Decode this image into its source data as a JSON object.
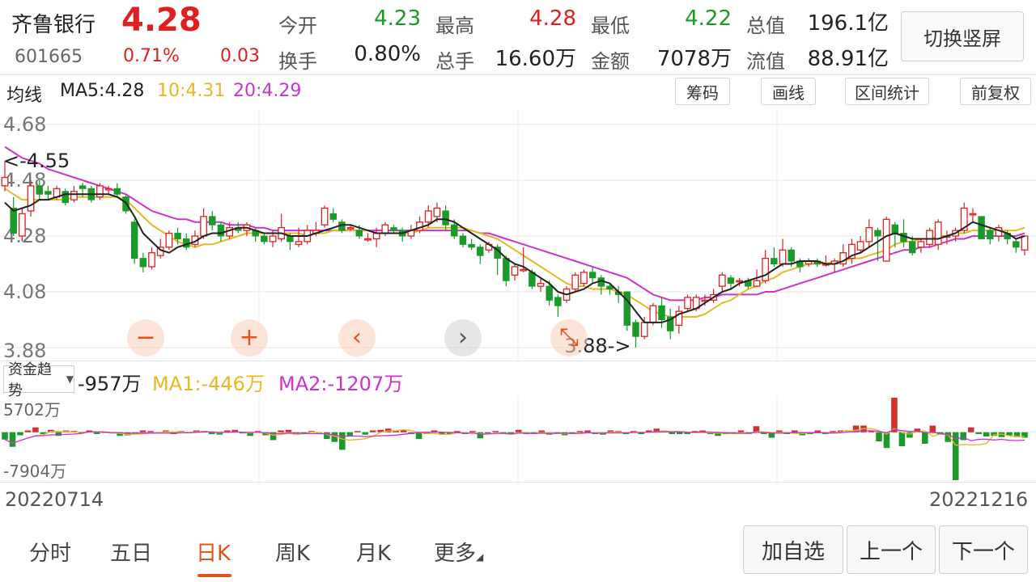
{
  "header": {
    "stock_name": "齐鲁银行",
    "price": "4.28",
    "code": "601665",
    "change_pct": "0.71%",
    "change_amt": "0.03",
    "stats": [
      {
        "label": "今开",
        "value": "4.23",
        "color": "green"
      },
      {
        "label": "最高",
        "value": "4.28",
        "color": "red"
      },
      {
        "label": "最低",
        "value": "4.22",
        "color": "green"
      },
      {
        "label": "总值",
        "value": "196.1亿",
        "color": "dark"
      },
      {
        "label": "换手",
        "value": "0.80%",
        "color": "dark"
      },
      {
        "label": "总手",
        "value": "16.60万",
        "color": "dark"
      },
      {
        "label": "金额",
        "value": "7078万",
        "color": "dark"
      },
      {
        "label": "流值",
        "value": "88.91亿",
        "color": "dark"
      }
    ],
    "switch_button": "切换竖屏"
  },
  "ma_bar": {
    "title": "均线",
    "ma5": "MA5:4.28",
    "ma10": "10:4.31",
    "ma20": "20:4.29",
    "buttons": [
      "筹码",
      "画线",
      "区间统计",
      "前复权"
    ]
  },
  "zoom_controls": [
    "zoom-out",
    "zoom-in",
    "scroll-left",
    "scroll-right",
    "collapse"
  ],
  "fund_bar": {
    "selector": "资金趋势",
    "value": "-957万",
    "ma1": "MA1:-446万",
    "ma2": "MA2:-1207万"
  },
  "dates": {
    "start": "20220714",
    "end": "20221216"
  },
  "tabs": [
    {
      "label": "分时",
      "active": false
    },
    {
      "label": "五日",
      "active": false
    },
    {
      "label": "日K",
      "active": true
    },
    {
      "label": "周K",
      "active": false
    },
    {
      "label": "月K",
      "active": false
    },
    {
      "label": "更多",
      "active": false
    }
  ],
  "bottom_buttons": [
    "加自选",
    "上一个",
    "下一个"
  ],
  "colors": {
    "up": "#e02020",
    "down": "#1a9a2a",
    "ma5": "#222222",
    "ma10": "#e8b820",
    "ma20": "#cc33cc",
    "accent": "#e2541c"
  },
  "chart_data": {
    "type": "candlestick",
    "y_ticks": [
      "4.68",
      "4.48",
      "4.28",
      "4.08",
      "3.88"
    ],
    "ylim": [
      3.88,
      4.68
    ],
    "max_label": "<-4.55",
    "min_label": "3.88->",
    "max_value": 4.55,
    "min_value": 3.88,
    "candles": [
      [
        4.46,
        4.49,
        4.55,
        4.44
      ],
      [
        4.38,
        4.29,
        4.42,
        4.28
      ],
      [
        4.28,
        4.36,
        4.38,
        4.26
      ],
      [
        4.37,
        4.46,
        4.48,
        4.35
      ],
      [
        4.46,
        4.43,
        4.48,
        4.41
      ],
      [
        4.44,
        4.43,
        4.46,
        4.41
      ],
      [
        4.42,
        4.45,
        4.46,
        4.41
      ],
      [
        4.44,
        4.4,
        4.45,
        4.39
      ],
      [
        4.41,
        4.44,
        4.46,
        4.4
      ],
      [
        4.46,
        4.45,
        4.47,
        4.42
      ],
      [
        4.45,
        4.41,
        4.46,
        4.4
      ],
      [
        4.42,
        4.46,
        4.47,
        4.41
      ],
      [
        4.45,
        4.45,
        4.46,
        4.43
      ],
      [
        4.45,
        4.43,
        4.47,
        4.42
      ],
      [
        4.42,
        4.37,
        4.43,
        4.36
      ],
      [
        4.33,
        4.2,
        4.34,
        4.18
      ],
      [
        4.2,
        4.17,
        4.22,
        4.15
      ],
      [
        4.17,
        4.22,
        4.24,
        4.16
      ],
      [
        4.21,
        4.24,
        4.27,
        4.2
      ],
      [
        4.24,
        4.29,
        4.3,
        4.23
      ],
      [
        4.29,
        4.27,
        4.31,
        4.25
      ],
      [
        4.27,
        4.24,
        4.29,
        4.23
      ],
      [
        4.25,
        4.28,
        4.3,
        4.24
      ],
      [
        4.28,
        4.35,
        4.38,
        4.27
      ],
      [
        4.35,
        4.32,
        4.37,
        4.3
      ],
      [
        4.32,
        4.28,
        4.33,
        4.26
      ],
      [
        4.28,
        4.31,
        4.33,
        4.27
      ],
      [
        4.31,
        4.3,
        4.33,
        4.29
      ],
      [
        4.3,
        4.32,
        4.33,
        4.28
      ],
      [
        4.3,
        4.28,
        4.31,
        4.26
      ],
      [
        4.28,
        4.26,
        4.29,
        4.25
      ],
      [
        4.26,
        4.28,
        4.3,
        4.24
      ],
      [
        4.27,
        4.31,
        4.36,
        4.26
      ],
      [
        4.28,
        4.26,
        4.29,
        4.23
      ],
      [
        4.25,
        4.26,
        4.31,
        4.24
      ],
      [
        4.26,
        4.3,
        4.32,
        4.25
      ],
      [
        4.29,
        4.3,
        4.33,
        4.28
      ],
      [
        4.32,
        4.38,
        4.39,
        4.31
      ],
      [
        4.36,
        4.34,
        4.38,
        4.33
      ],
      [
        4.33,
        4.3,
        4.34,
        4.29
      ],
      [
        4.31,
        4.31,
        4.32,
        4.3
      ],
      [
        4.3,
        4.28,
        4.32,
        4.27
      ],
      [
        4.27,
        4.27,
        4.29,
        4.26
      ],
      [
        4.27,
        4.29,
        4.31,
        4.24
      ],
      [
        4.29,
        4.32,
        4.33,
        4.28
      ],
      [
        4.31,
        4.3,
        4.32,
        4.29
      ],
      [
        4.3,
        4.28,
        4.31,
        4.26
      ],
      [
        4.28,
        4.3,
        4.32,
        4.27
      ],
      [
        4.3,
        4.33,
        4.35,
        4.29
      ],
      [
        4.33,
        4.37,
        4.39,
        4.31
      ],
      [
        4.35,
        4.38,
        4.4,
        4.33
      ],
      [
        4.37,
        4.32,
        4.39,
        4.3
      ],
      [
        4.32,
        4.28,
        4.34,
        4.27
      ],
      [
        4.28,
        4.25,
        4.29,
        4.24
      ],
      [
        4.25,
        4.24,
        4.27,
        4.23
      ],
      [
        4.24,
        4.21,
        4.25,
        4.18
      ],
      [
        4.23,
        4.25,
        4.26,
        4.22
      ],
      [
        4.24,
        4.2,
        4.25,
        4.14
      ],
      [
        4.2,
        4.12,
        4.21,
        4.1
      ],
      [
        4.14,
        4.17,
        4.18,
        4.12
      ],
      [
        4.16,
        4.16,
        4.24,
        4.15
      ],
      [
        4.15,
        4.1,
        4.16,
        4.09
      ],
      [
        4.1,
        4.11,
        4.13,
        4.08
      ],
      [
        4.1,
        4.05,
        4.12,
        4.03
      ],
      [
        4.06,
        4.03,
        4.07,
        3.99
      ],
      [
        4.05,
        4.09,
        4.1,
        4.04
      ],
      [
        4.09,
        4.14,
        4.15,
        4.08
      ],
      [
        4.11,
        4.15,
        4.16,
        4.1
      ],
      [
        4.15,
        4.13,
        4.17,
        4.11
      ],
      [
        4.13,
        4.1,
        4.14,
        4.07
      ],
      [
        4.1,
        4.09,
        4.11,
        4.07
      ],
      [
        4.08,
        4.07,
        4.1,
        4.04
      ],
      [
        4.08,
        3.96,
        4.08,
        3.94
      ],
      [
        3.97,
        3.92,
        3.98,
        3.88
      ],
      [
        3.92,
        3.97,
        3.99,
        3.91
      ],
      [
        3.97,
        4.03,
        4.04,
        3.96
      ],
      [
        4.03,
        3.98,
        4.06,
        3.95
      ],
      [
        3.99,
        3.94,
        4.02,
        3.91
      ],
      [
        3.96,
        4.01,
        4.03,
        3.93
      ],
      [
        4.02,
        4.06,
        4.07,
        4.01
      ],
      [
        4.02,
        4.06,
        4.07,
        4.01
      ],
      [
        4.05,
        4.05,
        4.07,
        4.03
      ],
      [
        4.05,
        4.07,
        4.09,
        4.04
      ],
      [
        4.1,
        4.14,
        4.15,
        4.08
      ],
      [
        4.13,
        4.11,
        4.14,
        4.09
      ],
      [
        4.12,
        4.12,
        4.13,
        4.1
      ],
      [
        4.12,
        4.1,
        4.13,
        4.09
      ],
      [
        4.1,
        4.12,
        4.16,
        4.1
      ],
      [
        4.12,
        4.2,
        4.23,
        4.11
      ],
      [
        4.2,
        4.18,
        4.24,
        4.17
      ],
      [
        4.18,
        4.23,
        4.27,
        4.17
      ],
      [
        4.23,
        4.19,
        4.24,
        4.17
      ],
      [
        4.19,
        4.17,
        4.2,
        4.15
      ],
      [
        4.18,
        4.19,
        4.2,
        4.17
      ],
      [
        4.19,
        4.18,
        4.2,
        4.17
      ],
      [
        4.18,
        4.18,
        4.21,
        4.17
      ],
      [
        4.18,
        4.19,
        4.2,
        4.15
      ],
      [
        4.18,
        4.22,
        4.25,
        4.17
      ],
      [
        4.2,
        4.25,
        4.27,
        4.18
      ],
      [
        4.23,
        4.26,
        4.28,
        4.22
      ],
      [
        4.26,
        4.31,
        4.34,
        4.24
      ],
      [
        4.3,
        4.28,
        4.31,
        4.19
      ],
      [
        4.19,
        4.34,
        4.35,
        4.19
      ],
      [
        4.32,
        4.29,
        4.33,
        4.24
      ],
      [
        4.29,
        4.26,
        4.34,
        4.24
      ],
      [
        4.26,
        4.22,
        4.28,
        4.21
      ],
      [
        4.24,
        4.26,
        4.27,
        4.22
      ],
      [
        4.25,
        4.3,
        4.31,
        4.24
      ],
      [
        4.25,
        4.33,
        4.34,
        4.23
      ],
      [
        4.28,
        4.28,
        4.3,
        4.25
      ],
      [
        4.28,
        4.3,
        4.31,
        4.26
      ],
      [
        4.3,
        4.38,
        4.4,
        4.29
      ],
      [
        4.36,
        4.36,
        4.38,
        4.33
      ],
      [
        4.35,
        4.27,
        4.35,
        4.27
      ],
      [
        4.3,
        4.27,
        4.31,
        4.25
      ],
      [
        4.28,
        4.31,
        4.32,
        4.26
      ],
      [
        4.29,
        4.27,
        4.3,
        4.25
      ],
      [
        4.26,
        4.24,
        4.27,
        4.22
      ],
      [
        4.23,
        4.28,
        4.28,
        4.21
      ]
    ],
    "ma5": [
      4.4,
      4.37,
      4.38,
      4.39,
      4.41,
      4.41,
      4.42,
      4.43,
      4.43,
      4.43,
      4.43,
      4.43,
      4.43,
      4.42,
      4.4,
      4.35,
      4.29,
      4.26,
      4.23,
      4.22,
      4.24,
      4.25,
      4.26,
      4.28,
      4.29,
      4.29,
      4.3,
      4.31,
      4.31,
      4.3,
      4.29,
      4.29,
      4.29,
      4.28,
      4.28,
      4.28,
      4.29,
      4.3,
      4.31,
      4.32,
      4.32,
      4.31,
      4.3,
      4.29,
      4.29,
      4.29,
      4.29,
      4.3,
      4.31,
      4.32,
      4.34,
      4.34,
      4.33,
      4.31,
      4.29,
      4.27,
      4.25,
      4.23,
      4.2,
      4.18,
      4.17,
      4.15,
      4.13,
      4.11,
      4.08,
      4.07,
      4.08,
      4.09,
      4.11,
      4.12,
      4.11,
      4.08,
      4.05,
      4.01,
      3.97,
      3.97,
      3.97,
      3.98,
      4.0,
      4.01,
      4.02,
      4.04,
      4.06,
      4.08,
      4.09,
      4.11,
      4.12,
      4.13,
      4.14,
      4.16,
      4.18,
      4.18,
      4.19,
      4.19,
      4.19,
      4.18,
      4.18,
      4.19,
      4.21,
      4.22,
      4.24,
      4.26,
      4.28,
      4.29,
      4.28,
      4.27,
      4.27,
      4.27,
      4.27,
      4.28,
      4.29,
      4.31,
      4.33,
      4.32,
      4.31,
      4.3,
      4.29,
      4.27,
      4.28
    ],
    "ma10": [
      4.45,
      4.43,
      4.41,
      4.41,
      4.41,
      4.41,
      4.41,
      4.41,
      4.42,
      4.42,
      4.42,
      4.42,
      4.42,
      4.42,
      4.41,
      4.38,
      4.35,
      4.32,
      4.3,
      4.28,
      4.26,
      4.25,
      4.24,
      4.25,
      4.25,
      4.26,
      4.27,
      4.28,
      4.29,
      4.29,
      4.29,
      4.29,
      4.29,
      4.29,
      4.29,
      4.28,
      4.29,
      4.29,
      4.3,
      4.3,
      4.3,
      4.3,
      4.3,
      4.29,
      4.29,
      4.29,
      4.29,
      4.29,
      4.3,
      4.31,
      4.31,
      4.31,
      4.31,
      4.31,
      4.3,
      4.29,
      4.28,
      4.27,
      4.25,
      4.23,
      4.21,
      4.19,
      4.17,
      4.15,
      4.13,
      4.11,
      4.1,
      4.1,
      4.09,
      4.09,
      4.09,
      4.08,
      4.07,
      4.05,
      4.03,
      4.01,
      4.0,
      3.99,
      3.99,
      3.99,
      3.99,
      4.0,
      4.02,
      4.04,
      4.05,
      4.07,
      4.09,
      4.1,
      4.12,
      4.13,
      4.15,
      4.16,
      4.17,
      4.18,
      4.18,
      4.18,
      4.19,
      4.19,
      4.2,
      4.2,
      4.21,
      4.22,
      4.23,
      4.25,
      4.26,
      4.26,
      4.27,
      4.27,
      4.28,
      4.28,
      4.29,
      4.29,
      4.3,
      4.3,
      4.3,
      4.3,
      4.3,
      4.3,
      4.31
    ],
    "ma20": [
      4.6,
      4.58,
      4.56,
      4.55,
      4.54,
      4.52,
      4.51,
      4.5,
      4.49,
      4.48,
      4.47,
      4.46,
      4.45,
      4.44,
      4.43,
      4.41,
      4.39,
      4.37,
      4.36,
      4.35,
      4.34,
      4.34,
      4.33,
      4.33,
      4.33,
      4.33,
      4.32,
      4.32,
      4.32,
      4.31,
      4.31,
      4.3,
      4.3,
      4.3,
      4.3,
      4.3,
      4.3,
      4.3,
      4.3,
      4.3,
      4.3,
      4.3,
      4.3,
      4.3,
      4.3,
      4.3,
      4.3,
      4.3,
      4.3,
      4.3,
      4.3,
      4.3,
      4.3,
      4.3,
      4.3,
      4.29,
      4.29,
      4.28,
      4.27,
      4.26,
      4.25,
      4.24,
      4.23,
      4.22,
      4.21,
      4.2,
      4.19,
      4.18,
      4.17,
      4.16,
      4.15,
      4.14,
      4.13,
      4.11,
      4.09,
      4.07,
      4.06,
      4.05,
      4.05,
      4.05,
      4.05,
      4.06,
      4.06,
      4.07,
      4.07,
      4.07,
      4.07,
      4.07,
      4.08,
      4.08,
      4.09,
      4.1,
      4.11,
      4.12,
      4.13,
      4.14,
      4.15,
      4.16,
      4.17,
      4.18,
      4.19,
      4.2,
      4.21,
      4.22,
      4.23,
      4.23,
      4.24,
      4.24,
      4.25,
      4.26,
      4.27,
      4.27,
      4.28,
      4.28,
      4.28,
      4.28,
      4.28,
      4.28,
      4.29
    ],
    "fund_flow": {
      "y_top_label": "5702万",
      "y_bottom_label": "-7904万",
      "max": 5702,
      "min": -7904,
      "values": [
        -1200,
        -2400,
        -500,
        300,
        800,
        -300,
        400,
        -600,
        300,
        200,
        -200,
        300,
        -300,
        -150,
        -200,
        -600,
        -500,
        -200,
        300,
        200,
        -200,
        300,
        -300,
        200,
        -150,
        300,
        200,
        -300,
        -400,
        300,
        400,
        -200,
        -600,
        200,
        -500,
        -1300,
        300,
        400,
        -400,
        -300,
        200,
        -300,
        -1100,
        -1600,
        -2900,
        -600,
        200,
        -400,
        300,
        400,
        600,
        300,
        400,
        -300,
        -1100,
        -300,
        300,
        -400,
        -300,
        200,
        -300,
        200,
        -1000,
        -300,
        200,
        -300,
        -400,
        400,
        -300,
        -300,
        300,
        -400,
        -300,
        -500,
        -200,
        200,
        300,
        -300,
        -400,
        300,
        200,
        -300,
        200,
        -300,
        300,
        600,
        300,
        -300,
        -300,
        -300,
        200,
        300,
        -300,
        -600,
        -300,
        -300,
        300,
        -300,
        1000,
        -300,
        -900,
        300,
        -300,
        300,
        -500,
        -300,
        300,
        -300,
        200,
        300,
        300,
        1100,
        1100,
        300,
        -1500,
        -2600,
        5702,
        -2300,
        -900,
        600,
        -1900,
        1100,
        -400,
        -1600,
        -7904,
        -1300,
        800,
        -300,
        -700,
        -600,
        -800,
        -500,
        -800,
        -900
      ]
    }
  }
}
